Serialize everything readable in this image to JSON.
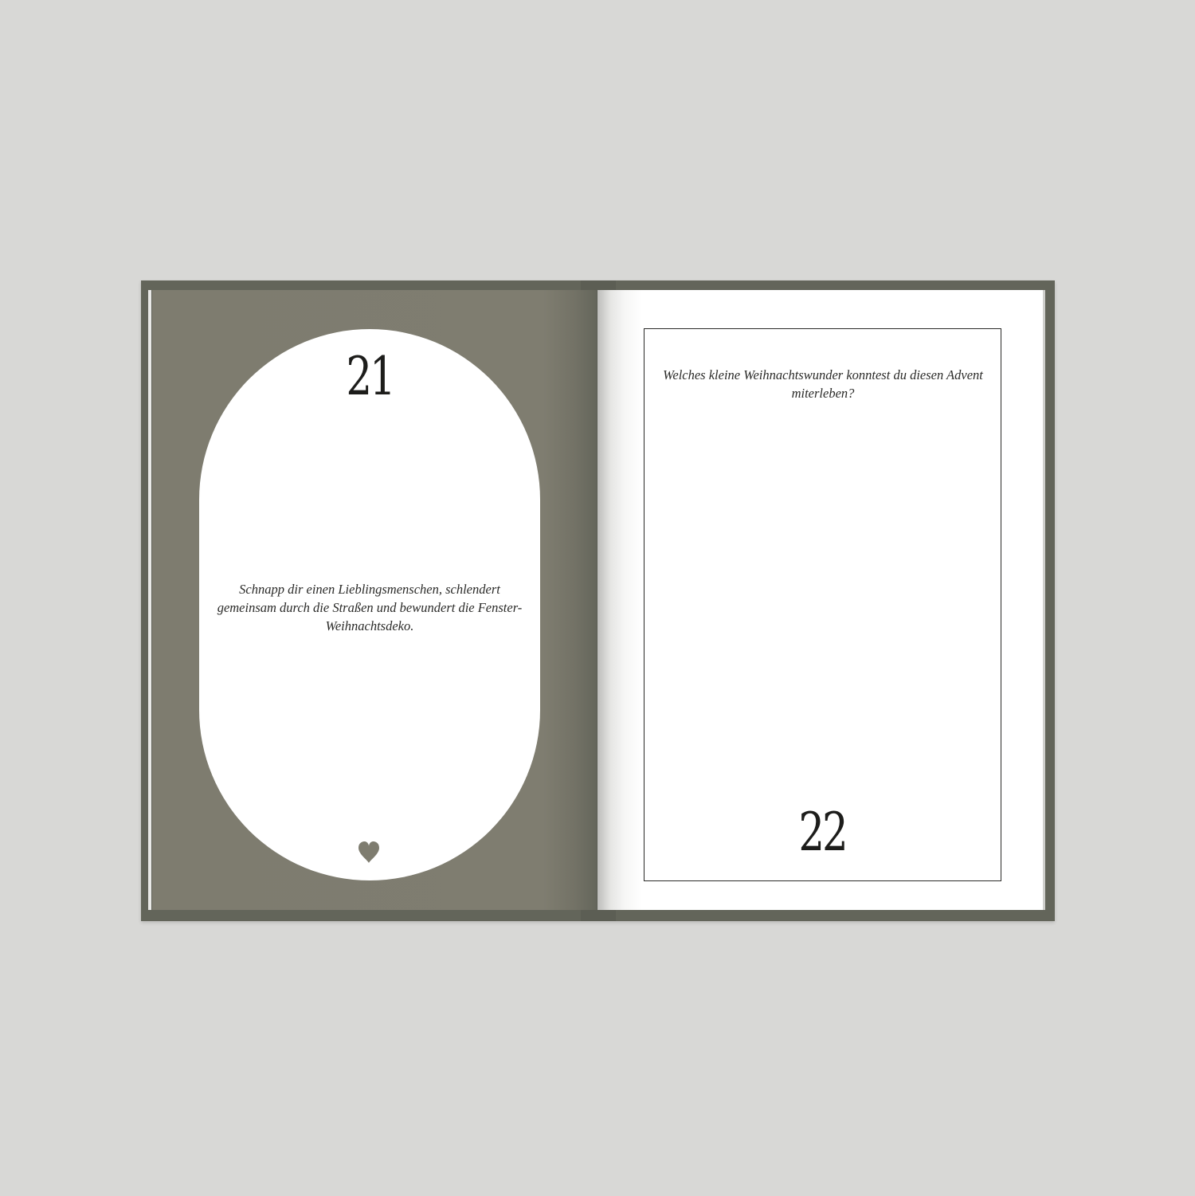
{
  "colors": {
    "background": "#d8d8d6",
    "cover": "#63655a",
    "left_page": "#7e7c6f",
    "heart": "#7e7c6f",
    "text": "#1d1d1b"
  },
  "left_page": {
    "day_number": "21",
    "quote": "Schnapp dir einen Lieblingsmenschen, schlendert gemeinsam durch die Straßen und bewundert die Fenster-Weihnachtsdeko.",
    "icon": "heart-icon"
  },
  "right_page": {
    "question": "Welches kleine Weihnachtswunder konntest du diesen Advent miterleben?",
    "day_number": "22"
  }
}
